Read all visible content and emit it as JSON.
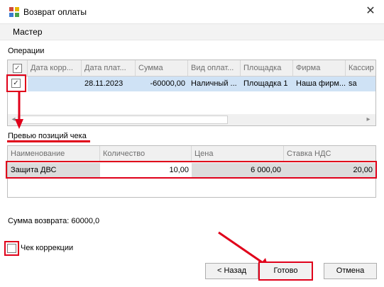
{
  "window": {
    "title": "Возврат оплаты",
    "close_glyph": "✕"
  },
  "wizard": {
    "step_label": "Мастер"
  },
  "operations": {
    "label": "Операции",
    "columns": [
      "Дата корр...",
      "Дата плат...",
      "Сумма",
      "Вид оплат...",
      "Площадка",
      "Фирма",
      "Кассир"
    ],
    "row": {
      "checked": true,
      "date_corr": "",
      "date_pay": "28.11.2023",
      "amount": "-60000,00",
      "pay_type": "Наличный ...",
      "site": "Площадка 1",
      "firm": "Наша фирм...",
      "cashier": "sa"
    }
  },
  "preview": {
    "label": "Превью позиций чека",
    "columns": [
      "Наименование",
      "Количество",
      "Цена",
      "Ставка НДС"
    ],
    "row": {
      "name": "Защита ДВС",
      "qty": "10,00",
      "price": "6 000,00",
      "vat": "20,00"
    }
  },
  "refund_total": "Сумма возврата: 60000,0",
  "correction": {
    "label": "Чек коррекции",
    "checked": false
  },
  "buttons": {
    "back": "< Назад",
    "done": "Готово",
    "cancel": "Отмена"
  },
  "colors": {
    "annotation": "#e0001a",
    "selection": "#cfe2f5"
  },
  "icons": {
    "app": "app-icon",
    "check": "✓",
    "scroll_left": "◂",
    "scroll_right": "▸"
  }
}
